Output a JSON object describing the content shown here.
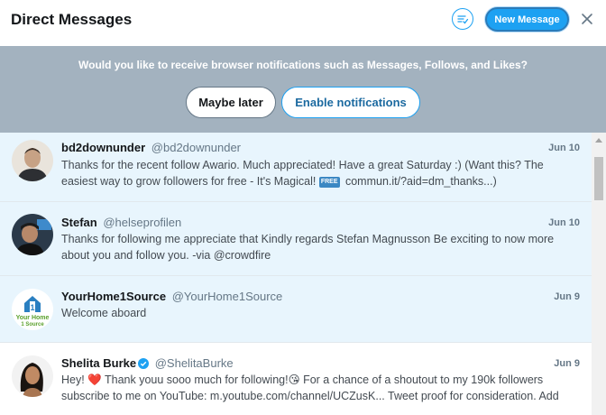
{
  "header": {
    "title": "Direct Messages",
    "mark_read_icon": "mark-all-read-icon",
    "new_message_label": "New Message",
    "close_icon": "close-icon"
  },
  "banner": {
    "text": "Would you like to receive browser notifications such as Messages, Follows, and Likes?",
    "later_label": "Maybe later",
    "enable_label": "Enable notifications"
  },
  "conversations": [
    {
      "name": "bd2downunder",
      "handle": "@bd2downunder",
      "date": "Jun 10",
      "text_before": "Thanks for the recent follow Awario. Much appreciated! Have a great Saturday :) (Want this? The easiest way to grow followers for free - It's Magical! ",
      "badge": "FREE",
      "text_after": " commun.it/?aid=dm_thanks...)",
      "unread": true
    },
    {
      "name": "Stefan",
      "handle": "@helseprofilen",
      "date": "Jun 10",
      "text": "Thanks for following me appreciate that Kindly regards Stefan Magnusson Be exciting to now more about you and follow you. -via @crowdfire",
      "unread": true
    },
    {
      "name": "YourHome1Source",
      "handle": "@YourHome1Source",
      "date": "Jun 9",
      "text": "Welcome aboard",
      "avatar_text": [
        "Your Home",
        "1 Source"
      ],
      "unread": true
    },
    {
      "name": "Shelita Burke",
      "handle": "@ShelitaBurke",
      "date": "Jun 9",
      "text": "Hey! ❤️ Thank youu sooo much for following!😘 For a chance of a shoutout to my 190k followers subscribe to me on YouTube: m.youtube.com/channel/UCZusK... Tweet proof for consideration. Add",
      "verified": true,
      "unread": false
    }
  ],
  "colors": {
    "accent": "#1da1f2",
    "banner": "#a3b2bf",
    "unread_bg": "#e8f5fd"
  }
}
